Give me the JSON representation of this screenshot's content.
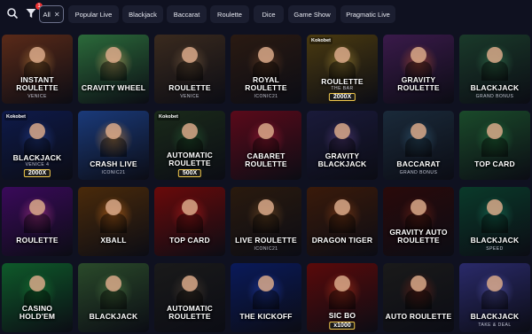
{
  "filters": {
    "search_icon": "search-icon",
    "filter_icon": "filter-icon",
    "filter_badge": "1",
    "chips": [
      {
        "label": "All",
        "active": true
      },
      {
        "label": "Popular Live"
      },
      {
        "label": "Blackjack"
      },
      {
        "label": "Baccarat"
      },
      {
        "label": "Roulette"
      },
      {
        "label": "Dice"
      },
      {
        "label": "Game Show"
      },
      {
        "label": "Pragmatic Live"
      }
    ]
  },
  "games": [
    {
      "title": "INSTANT ROULETTE",
      "sub": "VENICE",
      "bg": "#5a2a18",
      "glow": "#c98a40"
    },
    {
      "title": "CRAVITY WHEEL",
      "sub": "",
      "bg": "#2b6a3a",
      "glow": "#f0c070"
    },
    {
      "title": "ROULETTE",
      "sub": "VENICE",
      "bg": "#3a2a1e",
      "glow": "#8a6a4a"
    },
    {
      "title": "ROYAL ROULETTE",
      "sub": "ICONIC21",
      "bg": "#2a1a12",
      "glow": "#7a4a2a"
    },
    {
      "title": "ROULETTE",
      "sub": "THE BAR",
      "bg": "#4a3a10",
      "glow": "#c0a040",
      "brand": "Kokobet",
      "mult": "2000X"
    },
    {
      "title": "GRAVITY ROULETTE",
      "sub": "",
      "bg": "#3a1a4a",
      "glow": "#d05a30"
    },
    {
      "title": "BLACKJACK",
      "sub": "GRAND BONUS",
      "bg": "#1a3a2a",
      "glow": "#3a8a5a"
    },
    {
      "title": "BLACKJACK",
      "sub": "VENICE 4",
      "bg": "#0e1a4a",
      "glow": "#2a4aaa",
      "brand": "Kokobet",
      "mult": "2000X"
    },
    {
      "title": "CRASH LIVE",
      "sub": "ICONIC21",
      "bg": "#1a3a7a",
      "glow": "#f0a040"
    },
    {
      "title": "AUTOMATIC ROULETTE",
      "sub": "",
      "bg": "#1a2a1a",
      "glow": "#2a6a3a",
      "brand": "Kokobet",
      "mult": "500X"
    },
    {
      "title": "CABARET ROULETTE",
      "sub": "",
      "bg": "#5a0a1a",
      "glow": "#c02040"
    },
    {
      "title": "GRAVITY BLACKJACK",
      "sub": "",
      "bg": "#1a1a3a",
      "glow": "#6a4a9a"
    },
    {
      "title": "BACCARAT",
      "sub": "GRAND BONUS",
      "bg": "#1a2a3a",
      "glow": "#3a6a8a"
    },
    {
      "title": "TOP CARD",
      "sub": "",
      "bg": "#1a4a2a",
      "glow": "#2a8a4a"
    },
    {
      "title": "ROULETTE",
      "sub": "",
      "bg": "#3a0a5a",
      "glow": "#d040a0"
    },
    {
      "title": "XBALL",
      "sub": "",
      "bg": "#4a2a0a",
      "glow": "#f08020"
    },
    {
      "title": "TOP CARD",
      "sub": "",
      "bg": "#6a0a0a",
      "glow": "#d02020"
    },
    {
      "title": "LIVE ROULETTE",
      "sub": "ICONIC21",
      "bg": "#2a1a0e",
      "glow": "#8a5a2a"
    },
    {
      "title": "DRAGON TIGER",
      "sub": "",
      "bg": "#3a1a0a",
      "glow": "#a04a1a"
    },
    {
      "title": "GRAVITY AUTO ROULETTE",
      "sub": "",
      "bg": "#2a0a0a",
      "glow": "#8a2a1a"
    },
    {
      "title": "BLACKJACK",
      "sub": "SPEED",
      "bg": "#0a3a2a",
      "glow": "#1a8a6a"
    },
    {
      "title": "CASINO HOLD'EM",
      "sub": "",
      "bg": "#0e5a2a",
      "glow": "#1a8a3a"
    },
    {
      "title": "BLACKJACK",
      "sub": "",
      "bg": "#2a4a2a",
      "glow": "#5a8a4a"
    },
    {
      "title": "AUTOMATIC ROULETTE",
      "sub": "",
      "bg": "#1a1a1a",
      "glow": "#5a4a3a"
    },
    {
      "title": "THE KICKOFF",
      "sub": "",
      "bg": "#0a1a5a",
      "glow": "#2a4aca"
    },
    {
      "title": "SIC BO",
      "sub": "",
      "bg": "#5a0a0a",
      "glow": "#d04020",
      "mult": "x1000"
    },
    {
      "title": "AUTO ROULETTE",
      "sub": "",
      "bg": "#1a1a1a",
      "glow": "#8a2a1a"
    },
    {
      "title": "BLACKJACK",
      "sub": "TAKE & DEAL",
      "bg": "#2a2a6a",
      "glow": "#6a6ad0"
    }
  ]
}
